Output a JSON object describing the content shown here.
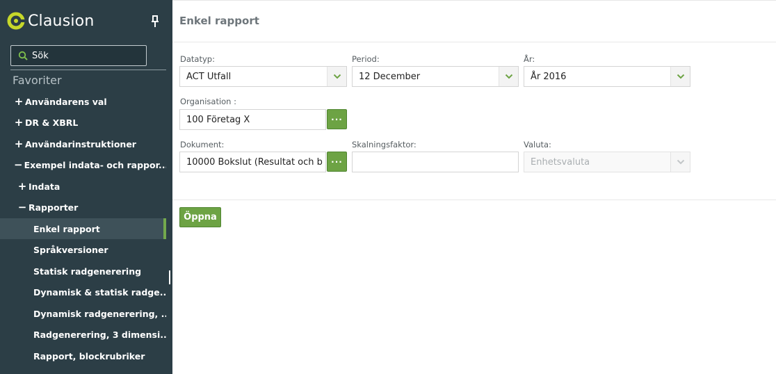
{
  "sidebar": {
    "logo_text": "Clausion",
    "search_placeholder": "Sök",
    "favorites_title": "Favoriter",
    "items": [
      {
        "sign": "+",
        "label": "Användarens val"
      },
      {
        "sign": "+",
        "label": "DR & XBRL"
      },
      {
        "sign": "+",
        "label": "Användarinstruktioner"
      },
      {
        "sign": "−",
        "label": "Exempel indata- och rappor..."
      },
      {
        "sign": "+",
        "label": "Indata"
      },
      {
        "sign": "−",
        "label": "Rapporter"
      },
      {
        "sign": "",
        "label": "Enkel rapport",
        "active": true
      },
      {
        "sign": "",
        "label": "Språkversioner"
      },
      {
        "sign": "",
        "label": "Statisk radgenerering"
      },
      {
        "sign": "",
        "label": "Dynamisk & statisk radge..."
      },
      {
        "sign": "",
        "label": "Dynamisk radgenerering, ..."
      },
      {
        "sign": "",
        "label": "Radgenerering, 3 dimensi..."
      },
      {
        "sign": "",
        "label": "Rapport, blockrubriker"
      }
    ],
    "accent_color": "#73a94d",
    "bg_color": "#2c3e46"
  },
  "main": {
    "title": "Enkel rapport",
    "fields": {
      "datatyp": {
        "label": "Datatyp:",
        "value": "ACT Utfall"
      },
      "period": {
        "label": "Period:",
        "value": "12 December"
      },
      "ar": {
        "label": "År:",
        "value": "År 2016"
      },
      "organisation": {
        "label": "Organisation :",
        "value": "100 Företag X"
      },
      "dokument": {
        "label": "Dokument:",
        "value": "10000 Bokslut (Resultat och b"
      },
      "skalningsfaktor": {
        "label": "Skalningsfaktor:",
        "value": ""
      },
      "valuta": {
        "label": "Valuta:",
        "value": "Enhetsvaluta"
      }
    },
    "lookup_button_label": "···",
    "open_button_label": "Öppna",
    "button_color": "#6da344"
  }
}
